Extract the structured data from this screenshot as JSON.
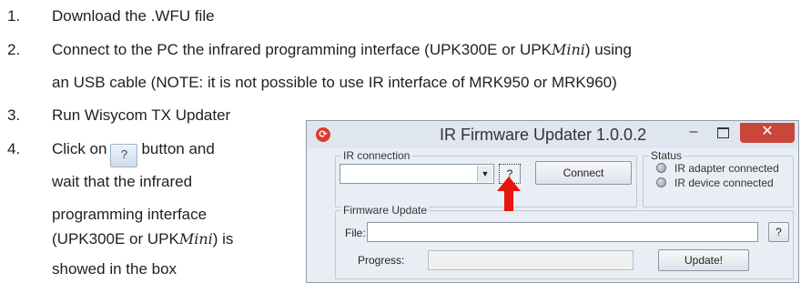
{
  "steps": [
    {
      "num": "1.",
      "text": "Download the .WFU file"
    },
    {
      "num": "2.",
      "line1_pre": "Connect to the PC the infrared programming interface (UPK300E or UPK",
      "line1_mini": "Mini",
      "line1_post": ") using",
      "line2": "an USB cable (NOTE: it is not possible to use IR interface of MRK950 or MRK960)"
    },
    {
      "num": "3.",
      "text": "Run Wisycom TX Updater"
    },
    {
      "num": "4.",
      "line1_pre": "Click on",
      "inline_button": "?",
      "line1_post": "button and",
      "line2": "wait that the infrared",
      "line3": "programming interface",
      "line4_pre": "(UPK300E or UPK",
      "line4_mini": "Mini",
      "line4_post": ") is",
      "line5": "showed in the box"
    }
  ],
  "dialog": {
    "title": "IR Firmware Updater 1.0.0.2",
    "icons": {
      "app": "app-logo-icon",
      "minimize": "minimize-icon",
      "maximize": "maximize-icon",
      "close": "close-icon"
    },
    "titlebar_glyphs": {
      "app": "⟳",
      "minimize": "–",
      "close": "✕"
    },
    "ir_connection": {
      "legend": "IR connection",
      "combo_value": "",
      "combo_arrow": "▼",
      "search_button": "?",
      "connect_button": "Connect"
    },
    "status": {
      "legend": "Status",
      "adapter": "IR adapter connected",
      "device": "IR device connected"
    },
    "firmware_update": {
      "legend": "Firmware Update",
      "file_label": "File:",
      "file_value": "",
      "file_browse_button": "?",
      "progress_label": "Progress:",
      "progress": 0,
      "update_button": "Update!"
    },
    "colors": {
      "close_button": "#c9463d",
      "arrow": "#e8140f"
    }
  }
}
